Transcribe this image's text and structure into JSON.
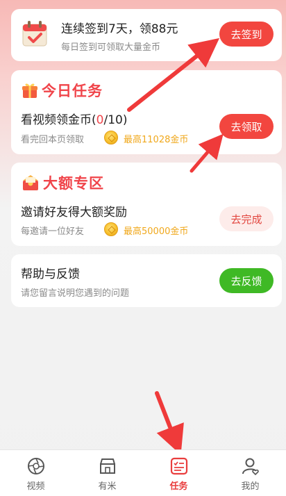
{
  "signin": {
    "title": "连续签到7天，领88元",
    "subtitle": "每日签到可领取大量金币",
    "button": "去签到"
  },
  "daily_tasks": {
    "heading": "今日任务",
    "task_title_prefix": "看视频领金币(",
    "task_progress": "0",
    "task_title_suffix": "/10)",
    "task_desc": "看完回本页领取",
    "reward": "最高11028金币",
    "button": "去领取"
  },
  "big_zone": {
    "heading": "大额专区",
    "task_title": "邀请好友得大额奖励",
    "task_desc": "每邀请一位好友",
    "reward": "最高50000金币",
    "button": "去完成"
  },
  "help": {
    "title": "帮助与反馈",
    "subtitle": "请您留言说明您遇到的问题",
    "button": "去反馈"
  },
  "tabbar": {
    "items": [
      {
        "label": "视频",
        "icon": "aperture-icon",
        "active": false
      },
      {
        "label": "有米",
        "icon": "shop-icon",
        "active": false
      },
      {
        "label": "任务",
        "icon": "task-list-icon",
        "active": true
      },
      {
        "label": "我的",
        "icon": "user-heart-icon",
        "active": false
      }
    ]
  },
  "colors": {
    "accent_red": "#f2463f",
    "accent_green": "#3fb925",
    "coin_text": "#f0a81c",
    "arrow_red": "#ef3a3a"
  }
}
